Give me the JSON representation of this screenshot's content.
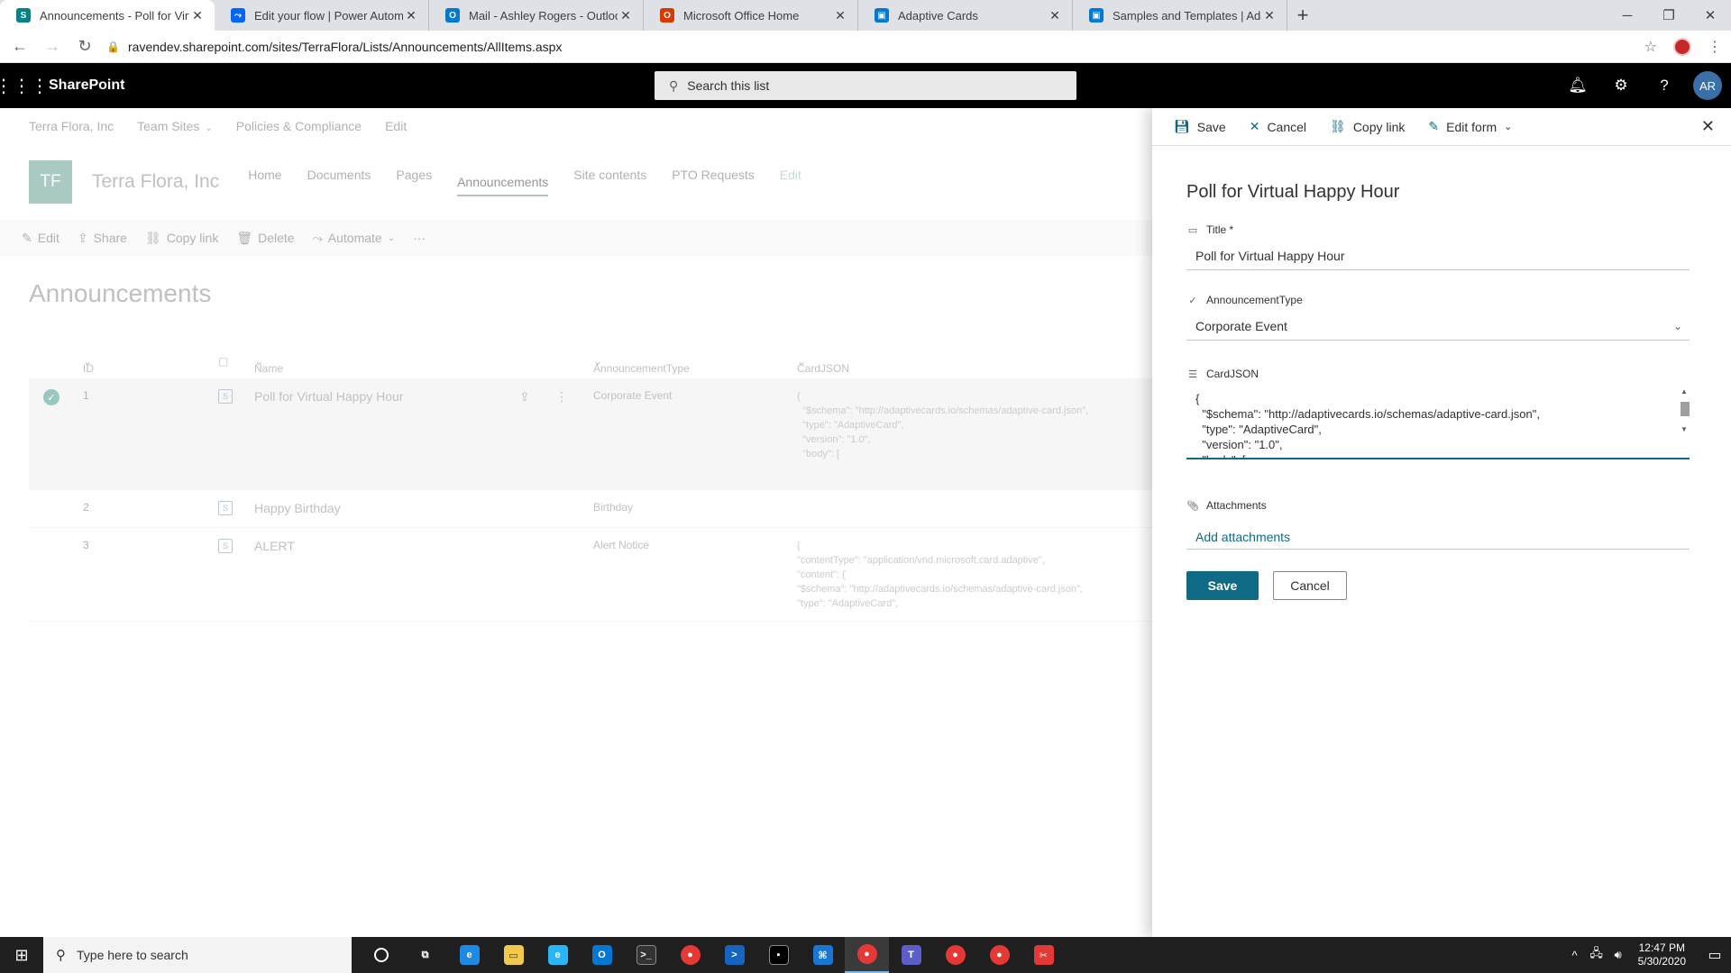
{
  "browser": {
    "tabs": [
      {
        "title": "Announcements - Poll for Virtual",
        "icon": "sharepoint-icon",
        "color": "#038387",
        "letter": "S",
        "active": true
      },
      {
        "title": "Edit your flow | Power Automate",
        "icon": "power-automate-icon",
        "color": "#0066ff",
        "letter": "⤳",
        "active": false
      },
      {
        "title": "Mail - Ashley Rogers - Outlook",
        "icon": "outlook-icon",
        "color": "#0078d4",
        "letter": "O",
        "active": false
      },
      {
        "title": "Microsoft Office Home",
        "icon": "office-icon",
        "color": "#d83b01",
        "letter": "O",
        "active": false
      },
      {
        "title": "Adaptive Cards",
        "icon": "adaptive-cards-icon",
        "color": "#0078d4",
        "letter": "▣",
        "active": false
      },
      {
        "title": "Samples and Templates | Adaptiv",
        "icon": "adaptive-cards-icon",
        "color": "#0078d4",
        "letter": "▣",
        "active": false
      }
    ],
    "url": "ravendev.sharepoint.com/sites/TerraFlora/Lists/Announcements/AllItems.aspx"
  },
  "suite": {
    "brand": "SharePoint",
    "search_placeholder": "Search this list",
    "avatar": "AR"
  },
  "hub_nav": {
    "items": [
      "Terra Flora, Inc",
      "Team Sites",
      "Policies & Compliance",
      "Edit"
    ]
  },
  "site": {
    "logo": "TF",
    "name": "Terra Flora, Inc",
    "nav": [
      "Home",
      "Documents",
      "Pages",
      "Announcements",
      "Site contents",
      "PTO Requests",
      "Edit"
    ]
  },
  "commands": [
    "Edit",
    "Share",
    "Copy link",
    "Delete",
    "Automate"
  ],
  "list": {
    "title": "Announcements",
    "columns": {
      "id": "ID",
      "name": "Name",
      "type": "AnnouncementType",
      "json": "CardJSON"
    },
    "rows": [
      {
        "id": "1",
        "name": "Poll for Virtual Happy Hour",
        "type": "Corporate Event",
        "json": "{\n  \"$schema\": \"http://adaptivecards.io/schemas/adaptive-card.json\",\n  \"type\": \"AdaptiveCard\",\n  \"version\": \"1.0\",\n  \"body\": ["
      },
      {
        "id": "2",
        "name": "Happy Birthday",
        "type": "Birthday",
        "json": ""
      },
      {
        "id": "3",
        "name": "ALERT",
        "type": "Alert Notice",
        "json": "{\n\"contentType\": \"application/vnd.microsoft.card.adaptive\",\n\"content\": {\n\"$schema\": \"http://adaptivecards.io/schemas/adaptive-card.json\",\n\"type\": \"AdaptiveCard\","
      }
    ]
  },
  "panel": {
    "commands": {
      "save": "Save",
      "cancel": "Cancel",
      "copy_link": "Copy link",
      "edit_form": "Edit form"
    },
    "title": "Poll for Virtual Happy Hour",
    "fields": {
      "title_label": "Title *",
      "title_value": "Poll for Virtual Happy Hour",
      "type_label": "AnnouncementType",
      "type_value": "Corporate Event",
      "json_label": "CardJSON",
      "json_value": "{\n  \"$schema\": \"http://adaptivecards.io/schemas/adaptive-card.json\",\n  \"type\": \"AdaptiveCard\",\n  \"version\": \"1.0\",\n  \"body\": [",
      "attach_label": "Attachments",
      "attach_link": "Add attachments"
    },
    "save_button": "Save",
    "cancel_button": "Cancel",
    "accent": "#0f6a86"
  },
  "taskbar": {
    "search_placeholder": "Type here to search",
    "time": "12:47 PM",
    "date": "5/30/2020"
  }
}
